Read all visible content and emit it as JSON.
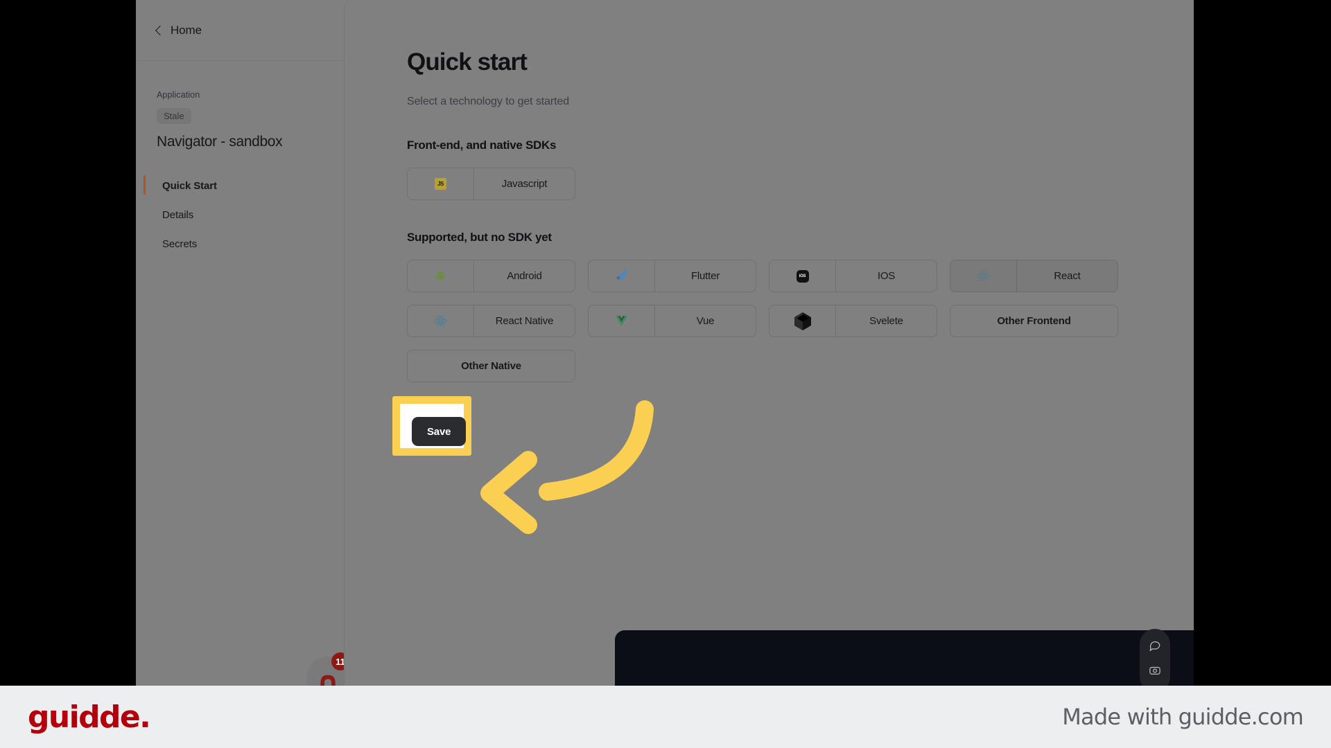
{
  "sidebar": {
    "back_label": "Home",
    "back_icon": "chevron-left-icon",
    "kicker": "Application",
    "status_badge": "Stale",
    "app_title": "Navigator - sandbox",
    "nav": [
      {
        "label": "Quick Start",
        "active": true
      },
      {
        "label": "Details",
        "active": false
      },
      {
        "label": "Secrets",
        "active": false
      }
    ]
  },
  "main": {
    "title": "Quick start",
    "subtitle": "Select a technology to get started",
    "sections": [
      {
        "heading": "Front-end, and native SDKs",
        "items": [
          {
            "label": "Javascript",
            "icon": "javascript-icon",
            "hover": false
          }
        ]
      },
      {
        "heading": "Supported, but no SDK yet",
        "items": [
          {
            "label": "Android",
            "icon": "android-icon",
            "hover": false
          },
          {
            "label": "Flutter",
            "icon": "flutter-icon",
            "hover": false
          },
          {
            "label": "IOS",
            "icon": "ios-icon",
            "hover": false
          },
          {
            "label": "React",
            "icon": "react-icon",
            "hover": true
          },
          {
            "label": "React Native",
            "icon": "react-icon",
            "hover": false
          },
          {
            "label": "Vue",
            "icon": "vue-icon",
            "hover": false
          },
          {
            "label": "Svelete",
            "icon": "svelte-icon",
            "hover": false
          },
          {
            "label": "Other Frontend",
            "icon": null,
            "hover": false
          },
          {
            "label": "Other Native",
            "icon": null,
            "hover": false
          }
        ]
      }
    ],
    "save_label": "Save"
  },
  "widgets": {
    "help_chat_icon": "chat-bubble-icon",
    "help_camera_icon": "camera-icon",
    "notification_count": "11"
  },
  "footer": {
    "logo": "guidde.",
    "made_with": "Made with guidde.com"
  },
  "colors": {
    "highlight": "#fbcf52",
    "accent": "#b4551f",
    "brand": "#b3000b",
    "save_button": "#2b2c30"
  }
}
